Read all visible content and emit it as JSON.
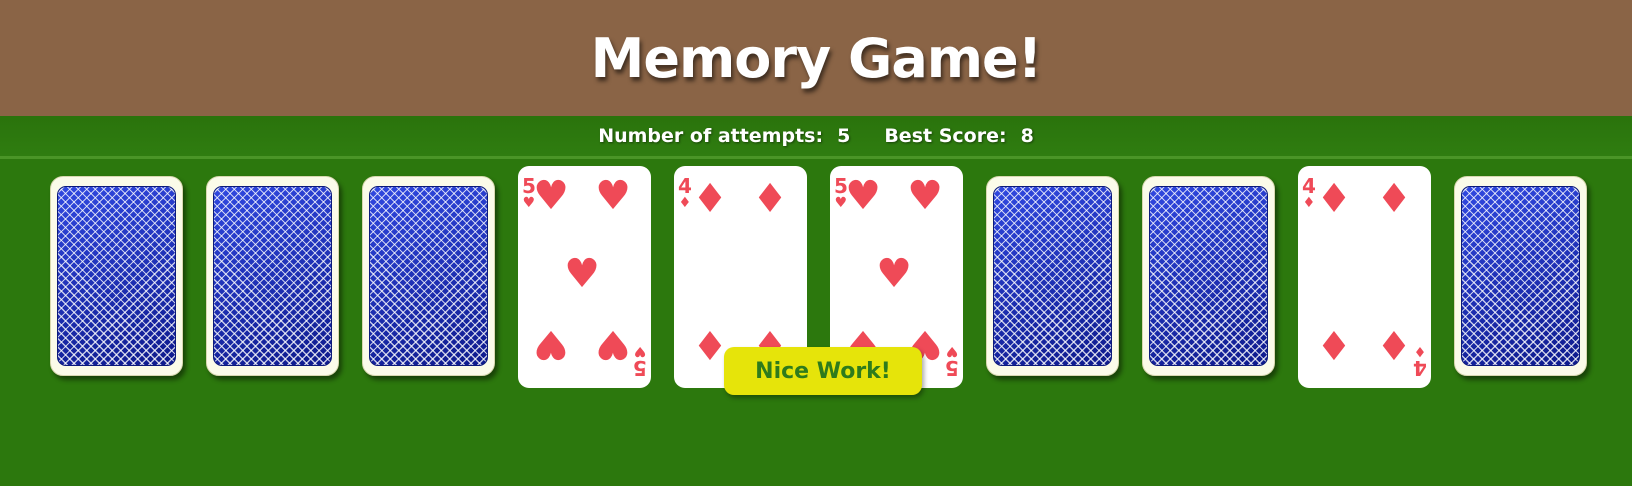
{
  "header": {
    "title": "Memory Game!"
  },
  "stats": {
    "attempts_label": "Number of attempts:",
    "attempts_value": "5",
    "best_label": "Best Score:",
    "best_value": "8"
  },
  "colors": {
    "felt_green": "#2c780d",
    "header_brown": "#8a6446",
    "card_red": "#ef4a57",
    "card_back_blue": "#1b2eb8",
    "toast_yellow": "#e6e40a"
  },
  "cards": [
    {
      "state": "face-down"
    },
    {
      "state": "face-down"
    },
    {
      "state": "face-down"
    },
    {
      "state": "face-up",
      "rank": "5",
      "suit": "hearts"
    },
    {
      "state": "face-up",
      "rank": "4",
      "suit": "diamonds"
    },
    {
      "state": "face-up",
      "rank": "5",
      "suit": "hearts"
    },
    {
      "state": "face-down"
    },
    {
      "state": "face-down"
    },
    {
      "state": "face-up",
      "rank": "4",
      "suit": "diamonds"
    },
    {
      "state": "face-down"
    }
  ],
  "message": "Nice Work!"
}
